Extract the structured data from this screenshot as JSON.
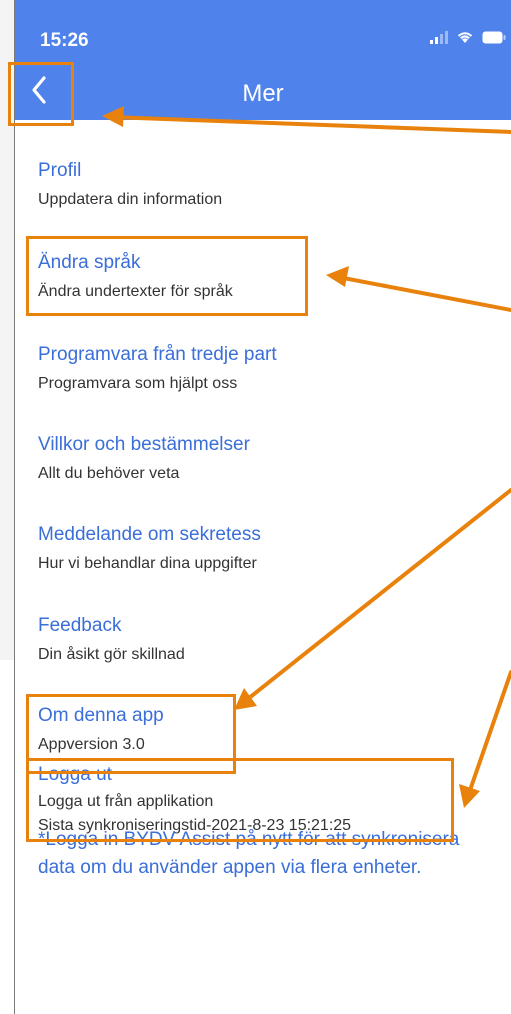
{
  "status_bar": {
    "time": "15:26"
  },
  "header": {
    "title": "Mer",
    "back_icon": "chevron-left-icon"
  },
  "menu": [
    {
      "title": "Profil",
      "subtitle": "Uppdatera din information"
    },
    {
      "title": "Ändra språk",
      "subtitle": "Ändra undertexter för språk"
    },
    {
      "title": "Programvara från tredje part",
      "subtitle": "Programvara som hjälpt oss"
    },
    {
      "title": "Villkor och bestämmelser",
      "subtitle": "Allt du behöver veta"
    },
    {
      "title": "Meddelande om sekretess",
      "subtitle": "Hur vi behandlar dina uppgifter"
    },
    {
      "title": "Feedback",
      "subtitle": "Din åsikt gör skillnad"
    },
    {
      "title": "Om denna app",
      "subtitle": "Appversion 3.0"
    },
    {
      "title": "Logga ut",
      "subtitle": "Logga ut från applikation",
      "subtitle2": "Sista synkroniseringstid-2021-8-23 15:21:25"
    }
  ],
  "footnote": "*Logga in BYDV Assist på nytt för att synkronisera data om du använder appen via flera enheter.",
  "colors": {
    "header": "#4f82eb",
    "link": "#3a6ed8",
    "highlight": "#e8820c"
  }
}
